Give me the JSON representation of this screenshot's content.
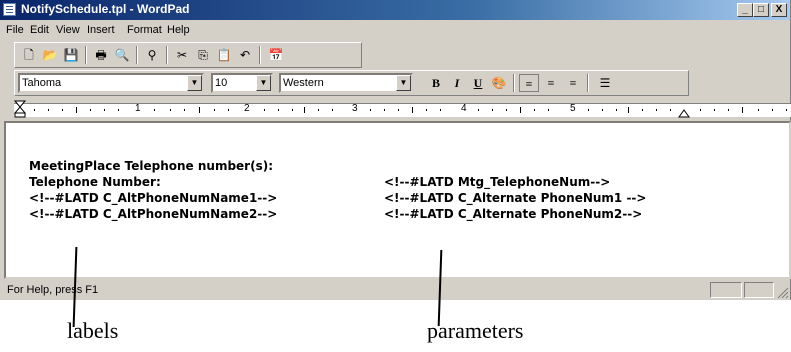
{
  "window": {
    "title": "NotifySchedule.tpl - WordPad"
  },
  "title_buttons": {
    "minimize": "_",
    "maximize": "□",
    "close": "X"
  },
  "menu": [
    "File",
    "Edit",
    "View",
    "Insert",
    "Format",
    "Help"
  ],
  "toolbar_icons": [
    "new-icon",
    "open-icon",
    "save-icon",
    "print-icon",
    "print-preview-icon",
    "find-icon",
    "cut-icon",
    "copy-icon",
    "paste-icon",
    "undo-icon",
    "date-time-icon"
  ],
  "format": {
    "font": "Tahoma",
    "size": "10",
    "script": "Western",
    "bold": "B",
    "italic": "I",
    "underline": "U"
  },
  "ruler": {
    "numbers": [
      "1",
      "2",
      "3",
      "4",
      "5"
    ]
  },
  "document": {
    "heading": "MeetingPlace Telephone number(s):",
    "rows": [
      {
        "left": "Telephone Number:",
        "right": "<!--#LATD Mtg_TelephoneNum-->"
      },
      {
        "left": "<!--#LATD C_AltPhoneNumName1-->",
        "right": "<!--#LATD C_Alternate PhoneNum1 -->"
      },
      {
        "left": "<!--#LATD C_AltPhoneNumName2-->",
        "right": "<!--#LATD C_Alternate PhoneNum2-->"
      }
    ]
  },
  "status": {
    "text": "For Help, press F1"
  },
  "annotations": {
    "labels": "labels",
    "parameters": "parameters"
  }
}
